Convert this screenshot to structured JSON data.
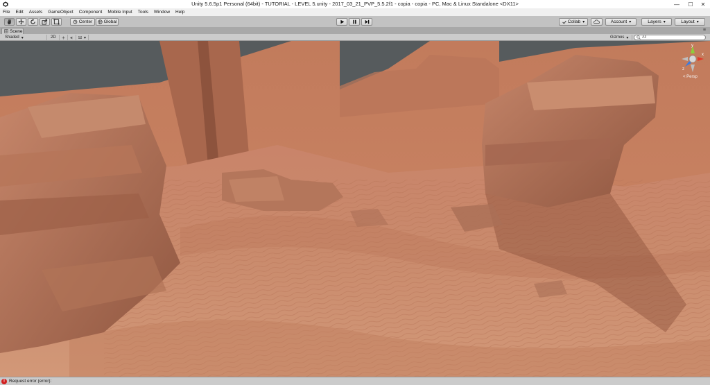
{
  "window": {
    "title": "Unity 5.6.5p1 Personal (64bit) - TUTORIAL - LEVEL 5.unity - 2017_03_21_PVP_5.5.2f1 - copia - copia - PC, Mac & Linux Standalone <DX11>",
    "minimize_glyph": "—",
    "maximize_glyph": "☐",
    "close_glyph": "✕"
  },
  "menu": [
    "File",
    "Edit",
    "Assets",
    "GameObject",
    "Component",
    "Mobile Input",
    "Tools",
    "Window",
    "Help"
  ],
  "toolbar": {
    "tools": [
      {
        "name": "hand-tool",
        "icon": "hand-icon",
        "active": true
      },
      {
        "name": "move-tool",
        "icon": "move-arrows-icon",
        "active": false
      },
      {
        "name": "rotate-tool",
        "icon": "rotate-icon",
        "active": false
      },
      {
        "name": "scale-tool",
        "icon": "scale-icon",
        "active": false
      },
      {
        "name": "rect-tool",
        "icon": "rect-icon",
        "active": false
      }
    ],
    "pivot_label": "Center",
    "space_label": "Global",
    "play_icon": "play-icon",
    "pause_icon": "pause-icon",
    "step_icon": "step-icon",
    "collab_label": "Collab",
    "cloud_icon": "cloud-icon",
    "account_label": "Account",
    "layers_label": "Layers",
    "layout_label": "Layout"
  },
  "scene": {
    "tab_label": "Scene",
    "shading_mode": "Shaded",
    "mode_2d_label": "2D",
    "gizmos_label": "Gizmos",
    "search_placeholder": "All",
    "projection_label": "< Persp",
    "gizmo_axes": {
      "y": "y",
      "x": "x",
      "z": "z"
    }
  },
  "status": {
    "message": "Request error (error):"
  },
  "colors": {
    "sky": "#565b5d",
    "sand": "#c9896b",
    "haze": "#c77f5f",
    "rock": "#b8775a",
    "error": "#d11f1f",
    "gizmo_x": "#e03a2a",
    "gizmo_y": "#8ccf3a",
    "gizmo_z": "#3a7be0"
  }
}
